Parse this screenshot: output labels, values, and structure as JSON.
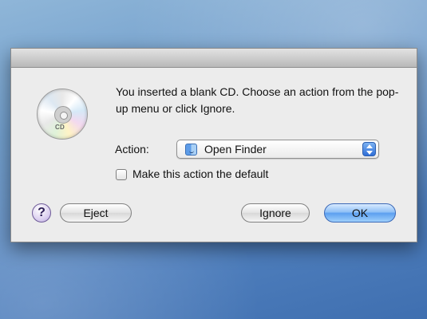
{
  "dialog": {
    "message": "You inserted a blank CD. Choose an action from the pop-up menu or click Ignore.",
    "cd_icon_label": "CD",
    "action_label": "Action:",
    "action_select": {
      "value": "Open Finder",
      "icon": "finder-icon"
    },
    "default_checkbox": {
      "label": "Make this action the default",
      "checked": false
    },
    "buttons": {
      "help": "?",
      "eject": "Eject",
      "ignore": "Ignore",
      "ok": "OK"
    }
  }
}
